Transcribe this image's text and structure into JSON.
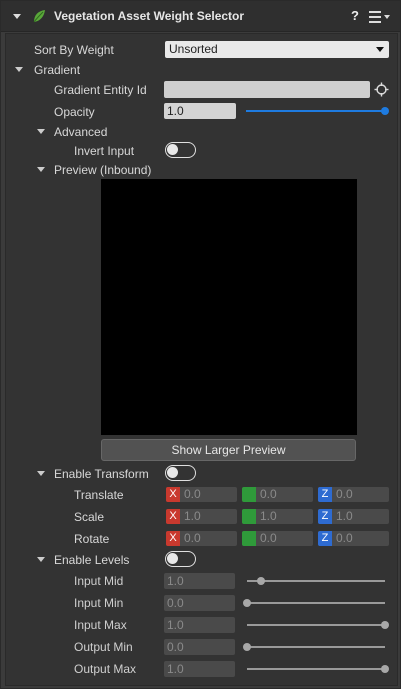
{
  "header": {
    "title": "Vegetation Asset Weight Selector",
    "help_label": "?",
    "leaf_color": "#5aa83a"
  },
  "sort": {
    "label": "Sort By Weight",
    "value": "Unsorted"
  },
  "gradient": {
    "section_label": "Gradient",
    "entity_id_label": "Gradient Entity Id",
    "entity_id_value": "",
    "opacity_label": "Opacity",
    "opacity_value": "1.0",
    "opacity_fraction": 1.0,
    "advanced_label": "Advanced",
    "invert_input_label": "Invert Input",
    "invert_input_on": false,
    "preview_label": "Preview (Inbound)",
    "show_larger_preview_label": "Show Larger Preview"
  },
  "transform": {
    "enable_label": "Enable Transform",
    "enabled": false,
    "rows": [
      {
        "label": "Translate",
        "x": "0.0",
        "y": "0.0",
        "z": "0.0"
      },
      {
        "label": "Scale",
        "x": "1.0",
        "y": "1.0",
        "z": "1.0"
      },
      {
        "label": "Rotate",
        "x": "0.0",
        "y": "0.0",
        "z": "0.0"
      }
    ],
    "axis_labels": {
      "x": "X",
      "y": "",
      "z": "Z"
    },
    "axis_colors": {
      "x": "#c9392e",
      "y": "#2f9a3a",
      "z": "#2e6bd1"
    }
  },
  "levels": {
    "enable_label": "Enable Levels",
    "enabled": false,
    "rows": [
      {
        "label": "Input Mid",
        "value": "1.0",
        "fraction": 0.1
      },
      {
        "label": "Input Min",
        "value": "0.0",
        "fraction": 0.0
      },
      {
        "label": "Input Max",
        "value": "1.0",
        "fraction": 1.0
      },
      {
        "label": "Output Min",
        "value": "0.0",
        "fraction": 0.0
      },
      {
        "label": "Output Max",
        "value": "1.0",
        "fraction": 1.0
      }
    ]
  },
  "colors": {
    "accent_blue": "#1e7be0"
  }
}
